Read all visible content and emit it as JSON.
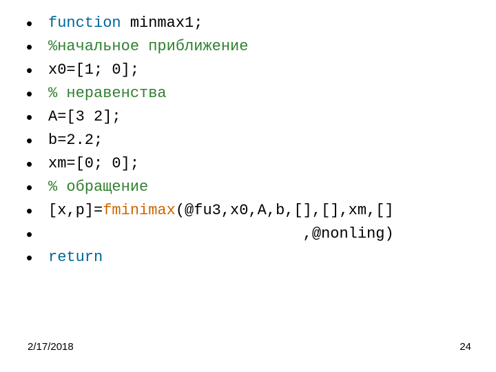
{
  "lines": [
    {
      "segments": [
        {
          "t": "function ",
          "cls": "kw-fn"
        },
        {
          "t": "minmax1;",
          "cls": ""
        }
      ]
    },
    {
      "segments": [
        {
          "t": "%начальное приближение",
          "cls": "kw-cmt"
        }
      ]
    },
    {
      "segments": [
        {
          "t": "x0=[1; 0];",
          "cls": ""
        }
      ]
    },
    {
      "segments": [
        {
          "t": "% неравенства",
          "cls": "kw-cmt"
        }
      ]
    },
    {
      "segments": [
        {
          "t": "A=[3 2];",
          "cls": ""
        }
      ]
    },
    {
      "segments": [
        {
          "t": "b=2.2;",
          "cls": ""
        }
      ]
    },
    {
      "segments": [
        {
          "t": "xm=[0; 0];",
          "cls": ""
        }
      ]
    },
    {
      "segments": [
        {
          "t": "% обращение",
          "cls": "kw-cmt"
        }
      ]
    },
    {
      "segments": [
        {
          "t": "[x,p]=",
          "cls": ""
        },
        {
          "t": "fminimax",
          "cls": "kw-call"
        },
        {
          "t": "(@fu3,x0,A,b,[],[],xm,[]",
          "cls": ""
        }
      ]
    },
    {
      "segments": [
        {
          "t": "                            ,@nonling)",
          "cls": ""
        }
      ]
    },
    {
      "segments": [
        {
          "t": "return",
          "cls": "kw-fn"
        }
      ]
    }
  ],
  "footer": {
    "date": "2/17/2018",
    "page": "24"
  },
  "bullet_char": "•"
}
